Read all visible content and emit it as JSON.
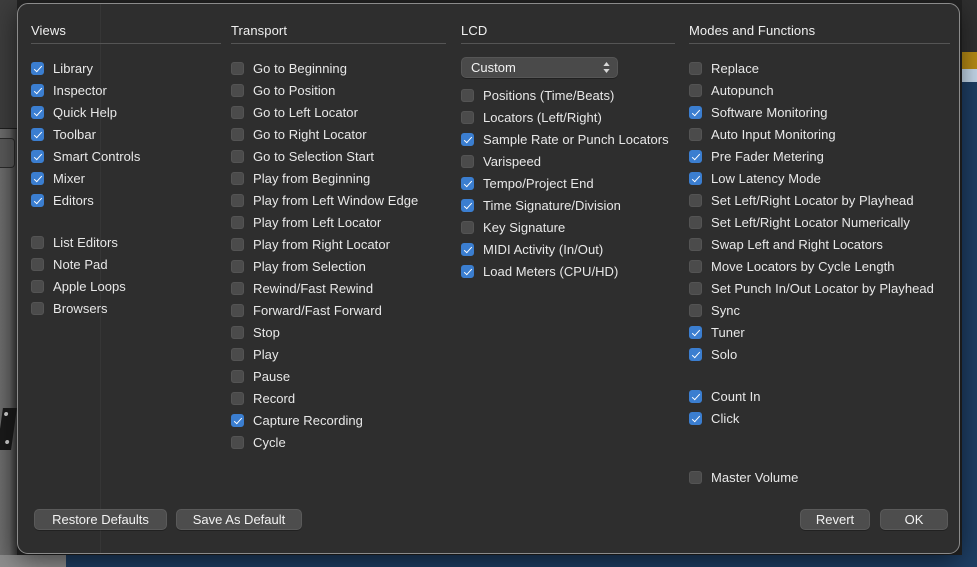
{
  "dialog": {
    "name": "customize-control-bar-and-display",
    "accent_color": "#3b7ed0",
    "background_color": "#2e2e2e"
  },
  "columns": [
    {
      "key": "views",
      "title": "Views",
      "items": [
        {
          "label": "Library",
          "checked": true,
          "gap": false
        },
        {
          "label": "Inspector",
          "checked": true,
          "gap": false
        },
        {
          "label": "Quick Help",
          "checked": true,
          "gap": false
        },
        {
          "label": "Toolbar",
          "checked": true,
          "gap": false
        },
        {
          "label": "Smart Controls",
          "checked": true,
          "gap": false
        },
        {
          "label": "Mixer",
          "checked": true,
          "gap": false
        },
        {
          "label": "Editors",
          "checked": true,
          "gap": false
        },
        {
          "label": "List Editors",
          "checked": false,
          "gap": true
        },
        {
          "label": "Note Pad",
          "checked": false,
          "gap": false
        },
        {
          "label": "Apple Loops",
          "checked": false,
          "gap": false
        },
        {
          "label": "Browsers",
          "checked": false,
          "gap": false
        }
      ]
    },
    {
      "key": "transport",
      "title": "Transport",
      "items": [
        {
          "label": "Go to Beginning",
          "checked": false,
          "gap": false
        },
        {
          "label": "Go to Position",
          "checked": false,
          "gap": false
        },
        {
          "label": "Go to Left Locator",
          "checked": false,
          "gap": false
        },
        {
          "label": "Go to Right Locator",
          "checked": false,
          "gap": false
        },
        {
          "label": "Go to Selection Start",
          "checked": false,
          "gap": false
        },
        {
          "label": "Play from Beginning",
          "checked": false,
          "gap": false
        },
        {
          "label": "Play from Left Window Edge",
          "checked": false,
          "gap": false
        },
        {
          "label": "Play from Left Locator",
          "checked": false,
          "gap": false
        },
        {
          "label": "Play from Right Locator",
          "checked": false,
          "gap": false
        },
        {
          "label": "Play from Selection",
          "checked": false,
          "gap": false
        },
        {
          "label": "Rewind/Fast Rewind",
          "checked": false,
          "gap": false
        },
        {
          "label": "Forward/Fast Forward",
          "checked": false,
          "gap": false
        },
        {
          "label": "Stop",
          "checked": false,
          "gap": false
        },
        {
          "label": "Play",
          "checked": false,
          "gap": false
        },
        {
          "label": "Pause",
          "checked": false,
          "gap": false
        },
        {
          "label": "Record",
          "checked": false,
          "gap": false
        },
        {
          "label": "Capture Recording",
          "checked": true,
          "gap": false
        },
        {
          "label": "Cycle",
          "checked": false,
          "gap": false
        }
      ]
    },
    {
      "key": "lcd",
      "title": "LCD",
      "popup": {
        "name": "lcd-preset-popup",
        "value": "Custom",
        "icon": "updown-chevron-icon"
      },
      "items": [
        {
          "label": "Positions (Time/Beats)",
          "checked": false,
          "gap": false
        },
        {
          "label": "Locators (Left/Right)",
          "checked": false,
          "gap": false
        },
        {
          "label": "Sample Rate or Punch Locators",
          "checked": true,
          "gap": false
        },
        {
          "label": "Varispeed",
          "checked": false,
          "gap": false
        },
        {
          "label": "Tempo/Project End",
          "checked": true,
          "gap": false
        },
        {
          "label": "Time Signature/Division",
          "checked": true,
          "gap": false
        },
        {
          "label": "Key Signature",
          "checked": false,
          "gap": false
        },
        {
          "label": "MIDI Activity (In/Out)",
          "checked": true,
          "gap": false
        },
        {
          "label": "Load Meters (CPU/HD)",
          "checked": true,
          "gap": false
        }
      ]
    },
    {
      "key": "modes",
      "title": "Modes and Functions",
      "items": [
        {
          "label": "Replace",
          "checked": false,
          "gap": false
        },
        {
          "label": "Autopunch",
          "checked": false,
          "gap": false
        },
        {
          "label": "Software Monitoring",
          "checked": true,
          "gap": false
        },
        {
          "label": "Auto Input Monitoring",
          "checked": false,
          "gap": false
        },
        {
          "label": "Pre Fader Metering",
          "checked": true,
          "gap": false
        },
        {
          "label": "Low Latency Mode",
          "checked": true,
          "gap": false
        },
        {
          "label": "Set Left/Right Locator by Playhead",
          "checked": false,
          "gap": false
        },
        {
          "label": "Set Left/Right Locator Numerically",
          "checked": false,
          "gap": false
        },
        {
          "label": "Swap Left and Right Locators",
          "checked": false,
          "gap": false
        },
        {
          "label": "Move Locators by Cycle Length",
          "checked": false,
          "gap": false
        },
        {
          "label": "Set Punch In/Out Locator by Playhead",
          "checked": false,
          "gap": false
        },
        {
          "label": "Sync",
          "checked": false,
          "gap": false
        },
        {
          "label": "Tuner",
          "checked": true,
          "gap": false
        },
        {
          "label": "Solo",
          "checked": true,
          "gap": false
        },
        {
          "label": "Count In",
          "checked": true,
          "gap": true
        },
        {
          "label": "Click",
          "checked": true,
          "gap": false
        },
        {
          "label": "Master Volume",
          "checked": false,
          "gap": "big"
        }
      ]
    }
  ],
  "footer": {
    "restore_defaults": "Restore Defaults",
    "save_as_default": "Save As Default",
    "revert": "Revert",
    "ok": "OK"
  }
}
